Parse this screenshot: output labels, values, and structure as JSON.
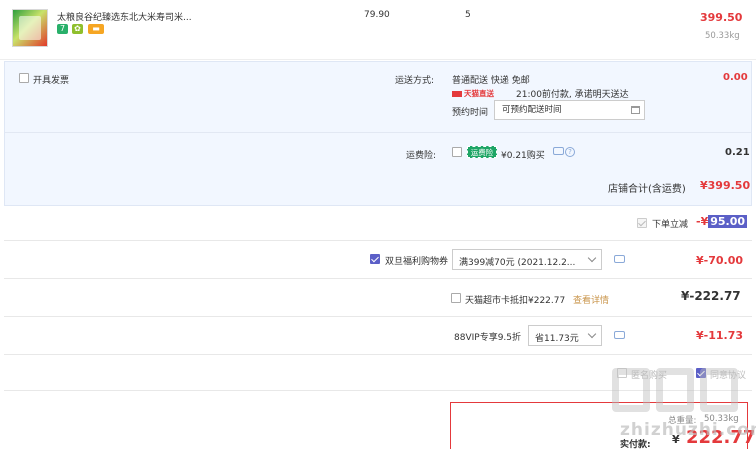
{
  "product": {
    "name": "太粮良谷纪臻选东北大米寿司米...",
    "badges": [
      "7",
      "✿",
      "▬"
    ],
    "unit_price": "79.90",
    "quantity": "5",
    "subtotal": "399.50",
    "weight": "50.33kg"
  },
  "invoice": {
    "label": "开具发票"
  },
  "shipping": {
    "label": "运送方式:",
    "method": "普通配送 快递 免邮",
    "fee": "0.00",
    "tmall_tag": "天猫直送",
    "delivery_note": "21:00前付款, 承诺明天送达",
    "appointment_label": "预约时间",
    "appointment_placeholder": "可预约配送时间"
  },
  "insurance": {
    "label": "运费险:",
    "badge": "运费险",
    "price_text": "¥0.21购买",
    "help": "?",
    "amount": "0.21"
  },
  "store_total": {
    "label": "店铺合计(含运费)",
    "value": "¥399.50"
  },
  "discounts": {
    "instant": {
      "label": "下单立减",
      "prefix": "-¥",
      "value": "95.00"
    },
    "coupon": {
      "label": "双旦福利购物券",
      "selected": "满399减70元 (2021.12.2...",
      "value": "¥-70.00"
    },
    "card": {
      "label": "天猫超市卡抵扣¥222.77",
      "detail": "查看详情",
      "value": "¥-222.77"
    },
    "vip": {
      "label": "88VIP专享9.5折",
      "selected": "省11.73元",
      "value": "¥-11.73"
    }
  },
  "bottom": {
    "anonymous_label": "匿名购买",
    "agree_label": "同意协议",
    "total_weight_label": "总重量:",
    "total_weight_value": "50.33kg",
    "actual_pay_label": "实付款:",
    "actual_pay_currency": "¥",
    "actual_pay_value": "222.77"
  },
  "watermark": {
    "text": "zhizhuzhi.com"
  },
  "colors": {
    "accent_red": "#e4393c",
    "checkbox_blue": "#5b5fc7",
    "panel_bg": "#f2f7ff"
  }
}
